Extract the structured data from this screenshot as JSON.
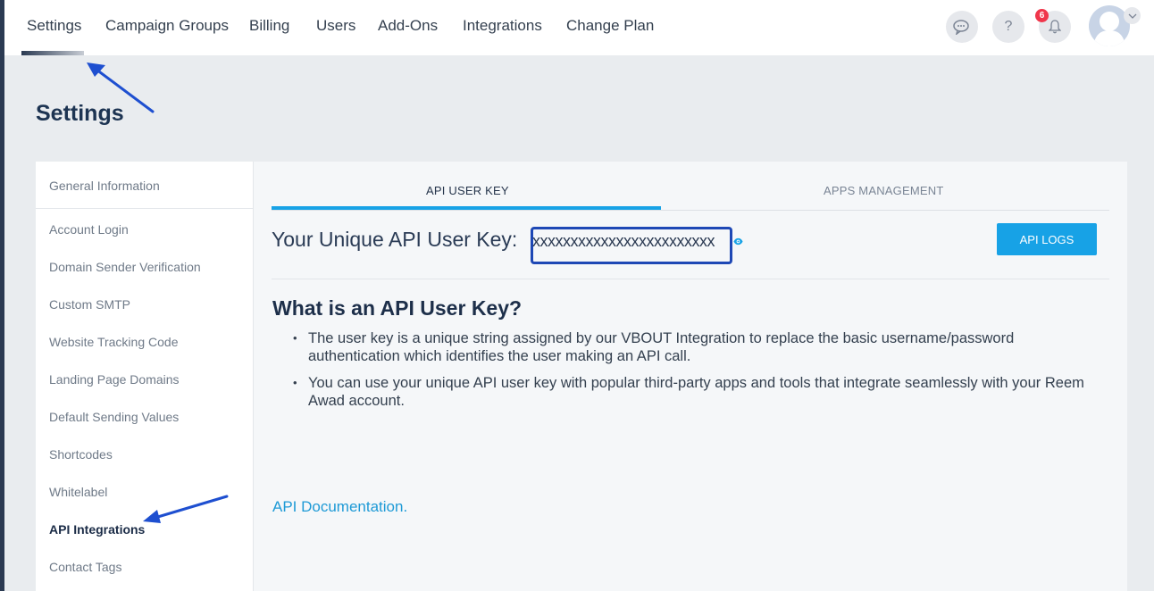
{
  "topnav": {
    "items": [
      "Settings",
      "Campaign Groups",
      "Billing",
      "Users",
      "Add-Ons",
      "Integrations",
      "Change Plan"
    ],
    "notification_count": "6",
    "icons": [
      "chat-icon",
      "help-icon",
      "bell-icon",
      "avatar",
      "chevron-down-icon"
    ]
  },
  "page": {
    "title": "Settings"
  },
  "sidebar": {
    "items": [
      "General Information",
      "Account Login",
      "Domain Sender Verification",
      "Custom SMTP",
      "Website Tracking Code",
      "Landing Page Domains",
      "Default Sending Values",
      "Shortcodes",
      "Whitelabel",
      "API Integrations",
      "Contact Tags"
    ],
    "active": "API Integrations"
  },
  "tabs": {
    "api_user_key": "API USER KEY",
    "apps_management": "APPS MANAGEMENT"
  },
  "api_key": {
    "label": "Your Unique API User Key:",
    "value": "xxxxxxxxxxxxxxxxxxxxxxxx",
    "logs_button": "API LOGS"
  },
  "info": {
    "title": "What is an API User Key?",
    "bullets": [
      "The user key is a unique string assigned by our VBOUT Integration to replace the basic username/password authentication which identifies the user making an API call.",
      "You can use your unique API user key with popular third-party apps and tools that integrate seamlessly with your Reem Awad account."
    ],
    "doc_link": "API Documentation."
  },
  "colors": {
    "accent": "#17a2e6",
    "highlight_box": "#1e48b5",
    "badge": "#f0364b"
  }
}
